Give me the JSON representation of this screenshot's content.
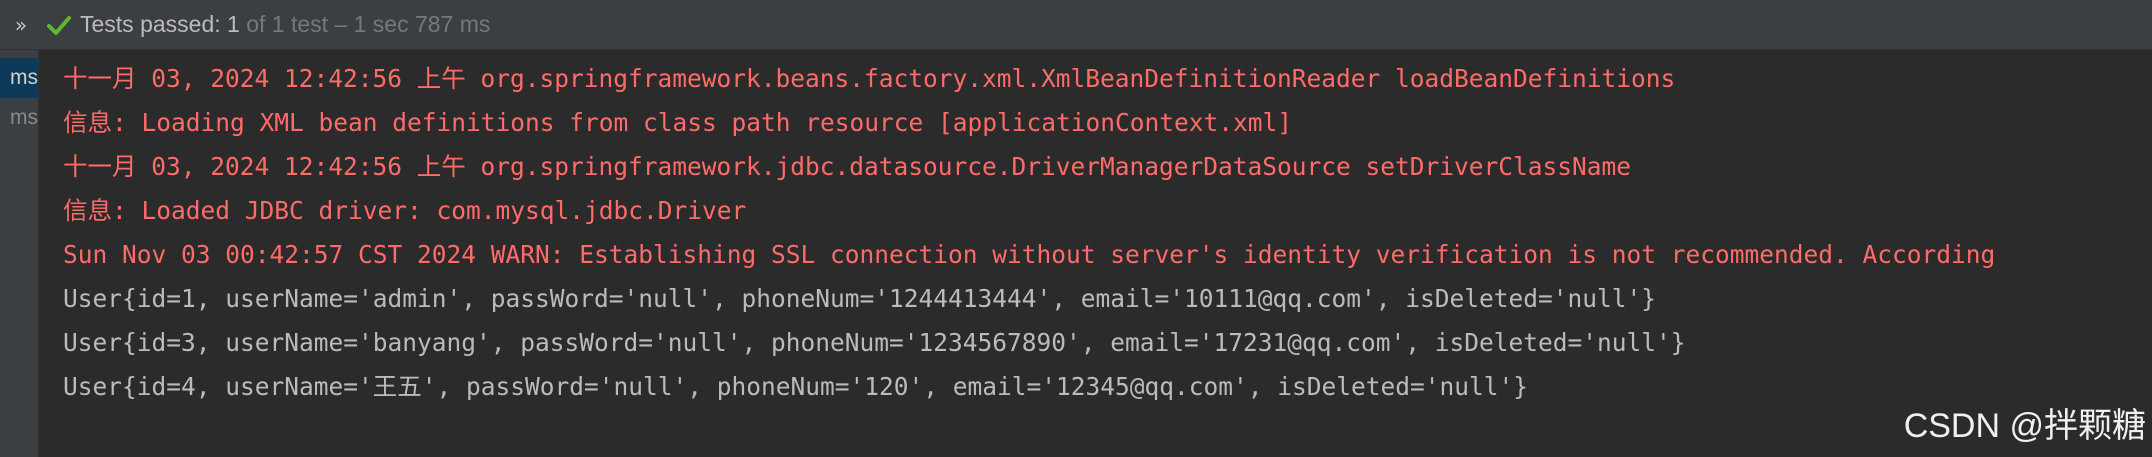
{
  "toolbar": {
    "expand_glyph": "»",
    "status_label": "Tests passed: ",
    "passed_count": "1",
    "status_detail": " of 1 test – 1 sec 787 ms",
    "colors": {
      "check": "#5fb832",
      "background": "#3c3f41"
    }
  },
  "gutter": {
    "items": [
      {
        "label": "ms"
      },
      {
        "label": "ms"
      }
    ]
  },
  "console": {
    "lines": [
      {
        "text": "十一月 03, 2024 12:42:56 上午 org.springframework.beans.factory.xml.XmlBeanDefinitionReader loadBeanDefinitions",
        "stream": "stderr"
      },
      {
        "text": "信息: Loading XML bean definitions from class path resource [applicationContext.xml]",
        "stream": "stderr"
      },
      {
        "text": "十一月 03, 2024 12:42:56 上午 org.springframework.jdbc.datasource.DriverManagerDataSource setDriverClassName",
        "stream": "stderr"
      },
      {
        "text": "信息: Loaded JDBC driver: com.mysql.jdbc.Driver",
        "stream": "stderr"
      },
      {
        "text": "Sun Nov 03 00:42:57 CST 2024 WARN: Establishing SSL connection without server's identity verification is not recommended. According",
        "stream": "stderr"
      },
      {
        "text": "User{id=1, userName='admin', passWord='null', phoneNum='1244413444', email='10111@qq.com', isDeleted='null'}",
        "stream": "stdout"
      },
      {
        "text": "User{id=3, userName='banyang', passWord='null', phoneNum='1234567890', email='17231@qq.com', isDeleted='null'}",
        "stream": "stdout"
      },
      {
        "text": "User{id=4, userName='王五', passWord='null', phoneNum='120', email='12345@qq.com', isDeleted='null'}",
        "stream": "stdout"
      }
    ],
    "colors": {
      "stderr": "#ff6b68",
      "stdout": "#bbbbbb",
      "background": "#2b2b2b"
    }
  },
  "watermark": {
    "text": "CSDN @拌颗糖"
  }
}
